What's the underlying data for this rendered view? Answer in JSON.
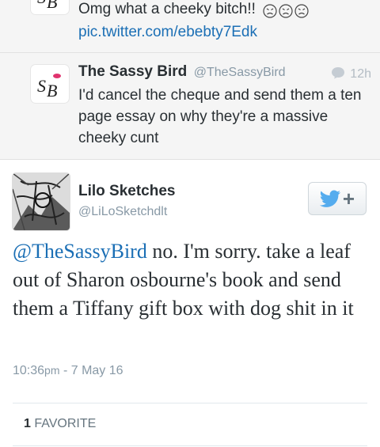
{
  "thread": {
    "reply_a": {
      "text": "Omg what a cheeky bitch!!",
      "emoji": [
        "tired-face-emoji",
        "tired-face-emoji",
        "tired-face-emoji"
      ],
      "link": "pic.twitter.com/ebebty7Edk"
    },
    "reply_b": {
      "name": "The Sassy Bird",
      "handle": "@TheSassyBird",
      "time": "12h",
      "text": "I'd cancel the cheque and send them a ten page essay on why they're a massive cheeky cunt"
    }
  },
  "main_tweet": {
    "name": "Lilo Sketches",
    "handle": "@LiLoSketchdlt",
    "mention": "@TheSassyBird",
    "text": " no. I'm sorry. take a leaf out of Sharon osbourne's book and send them a Tiffany gift box with dog shit in it",
    "time": "10:36",
    "ampm": "pm",
    "date_sep": " - ",
    "date": "7 May 16",
    "favorite_count": "1",
    "favorite_label": "FAVORITE"
  },
  "colors": {
    "link": "#1b6fb5",
    "twitter_bird": "#55acee",
    "logo_pink": "#e0336e"
  },
  "icons": {
    "follow": "twitter-bird-icon",
    "reply_count": "speech-bubble-icon"
  }
}
